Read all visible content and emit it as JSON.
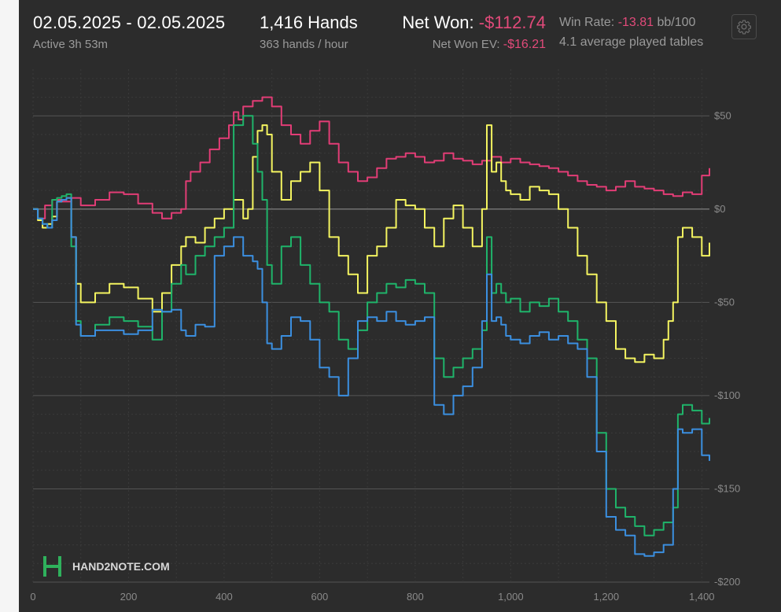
{
  "header": {
    "date_range": "02.05.2025 - 02.05.2025",
    "active": "Active 3h 53m",
    "hands": "1,416 Hands",
    "hands_per_hour": "363 hands / hour",
    "net_won_label": "Net Won: ",
    "net_won_value": "-$112.74",
    "net_won_ev_label": "Net Won  EV: ",
    "net_won_ev_value": "-$16.21",
    "win_rate_label": "Win Rate: ",
    "win_rate_value": "-13.81",
    "win_rate_unit": " bb/100",
    "avg_tables": "4.1 average played tables"
  },
  "settings": {
    "icon": "gear-icon"
  },
  "logo": {
    "text": "HAND2NOTE.COM"
  },
  "colors": {
    "background": "#2c2c2c",
    "negative": "#e24a7a",
    "pink": "#e23d76",
    "yellow": "#f4f460",
    "green": "#1fb46a",
    "blue": "#3b8fe0"
  },
  "chart_data": {
    "type": "line",
    "xlim": [
      0,
      1416
    ],
    "ylim": [
      -200,
      75
    ],
    "x_ticks": [
      0,
      200,
      400,
      600,
      800,
      1000,
      1200,
      1400
    ],
    "x_tick_labels": [
      "0",
      "200",
      "400",
      "600",
      "800",
      "1,000",
      "1,200",
      "1,400"
    ],
    "y_ticks": [
      50,
      0,
      -50,
      -100,
      -150,
      -200
    ],
    "y_tick_labels": [
      "$50",
      "$0",
      "-$50",
      "-$100",
      "-$150",
      "-$200"
    ],
    "grid": true,
    "series": [
      {
        "color": "#e23d76",
        "x": [
          0,
          10,
          25,
          40,
          60,
          80,
          100,
          130,
          160,
          190,
          220,
          250,
          270,
          290,
          310,
          320,
          330,
          350,
          370,
          390,
          410,
          420,
          430,
          440,
          460,
          480,
          500,
          520,
          540,
          560,
          580,
          600,
          620,
          640,
          660,
          680,
          700,
          720,
          740,
          760,
          780,
          800,
          820,
          840,
          860,
          880,
          900,
          920,
          940,
          960,
          980,
          1000,
          1020,
          1040,
          1060,
          1080,
          1100,
          1120,
          1140,
          1160,
          1180,
          1200,
          1220,
          1240,
          1260,
          1280,
          1300,
          1320,
          1340,
          1360,
          1380,
          1400,
          1416
        ],
        "y": [
          0,
          -5,
          2,
          5,
          4,
          6,
          2,
          5,
          9,
          8,
          3,
          -2,
          -5,
          -2,
          0,
          15,
          20,
          25,
          32,
          38,
          45,
          52,
          48,
          55,
          58,
          60,
          55,
          45,
          40,
          35,
          42,
          47,
          35,
          25,
          20,
          15,
          17,
          22,
          27,
          28,
          30,
          28,
          25,
          26,
          30,
          27,
          26,
          24,
          26,
          28,
          25,
          27,
          25,
          24,
          23,
          22,
          20,
          18,
          15,
          13,
          12,
          10,
          12,
          15,
          12,
          11,
          10,
          8,
          7,
          9,
          8,
          18,
          22
        ]
      },
      {
        "color": "#f4f460",
        "x": [
          0,
          10,
          20,
          30,
          40,
          50,
          60,
          70,
          80,
          90,
          100,
          130,
          160,
          190,
          220,
          250,
          270,
          290,
          310,
          320,
          340,
          360,
          380,
          400,
          420,
          440,
          450,
          460,
          470,
          480,
          490,
          500,
          520,
          540,
          560,
          580,
          600,
          620,
          640,
          660,
          680,
          700,
          720,
          740,
          760,
          780,
          800,
          820,
          840,
          860,
          880,
          900,
          920,
          940,
          950,
          960,
          970,
          980,
          990,
          1000,
          1020,
          1040,
          1060,
          1080,
          1100,
          1120,
          1140,
          1160,
          1180,
          1200,
          1220,
          1240,
          1260,
          1280,
          1300,
          1320,
          1330,
          1340,
          1350,
          1360,
          1380,
          1400,
          1416
        ],
        "y": [
          0,
          -6,
          -10,
          -8,
          -4,
          4,
          5,
          6,
          -15,
          -40,
          -50,
          -45,
          -40,
          -42,
          -48,
          -55,
          -45,
          -30,
          -20,
          -15,
          -18,
          -10,
          -5,
          0,
          5,
          -5,
          0,
          28,
          42,
          45,
          40,
          20,
          5,
          15,
          20,
          25,
          10,
          -15,
          -25,
          -35,
          -45,
          -25,
          -20,
          -10,
          5,
          2,
          0,
          -10,
          -20,
          -5,
          2,
          -10,
          -20,
          0,
          45,
          20,
          25,
          15,
          10,
          8,
          5,
          12,
          10,
          8,
          0,
          -10,
          -25,
          -35,
          -50,
          -60,
          -75,
          -80,
          -82,
          -78,
          -80,
          -70,
          -60,
          -50,
          -15,
          -10,
          -15,
          -25,
          -18
        ]
      },
      {
        "color": "#1fb46a",
        "x": [
          0,
          10,
          20,
          30,
          40,
          50,
          60,
          70,
          80,
          90,
          100,
          130,
          160,
          190,
          220,
          250,
          270,
          290,
          310,
          320,
          340,
          360,
          380,
          400,
          420,
          440,
          460,
          470,
          480,
          490,
          500,
          520,
          540,
          560,
          580,
          600,
          620,
          640,
          660,
          680,
          700,
          720,
          740,
          760,
          780,
          800,
          820,
          840,
          860,
          880,
          900,
          920,
          940,
          950,
          960,
          970,
          980,
          990,
          1000,
          1020,
          1040,
          1060,
          1080,
          1100,
          1120,
          1140,
          1160,
          1180,
          1200,
          1220,
          1240,
          1260,
          1280,
          1300,
          1320,
          1340,
          1350,
          1360,
          1380,
          1400,
          1416
        ],
        "y": [
          0,
          -5,
          -8,
          -10,
          5,
          6,
          7,
          8,
          -20,
          -60,
          -68,
          -62,
          -58,
          -60,
          -63,
          -70,
          -55,
          -40,
          -30,
          -35,
          -25,
          -20,
          -15,
          -10,
          45,
          50,
          35,
          20,
          5,
          -30,
          -40,
          -20,
          -15,
          -30,
          -40,
          -50,
          -55,
          -70,
          -75,
          -65,
          -50,
          -45,
          -40,
          -42,
          -38,
          -40,
          -45,
          -80,
          -90,
          -85,
          -80,
          -75,
          -65,
          -15,
          -45,
          -40,
          -45,
          -50,
          -48,
          -55,
          -50,
          -52,
          -48,
          -55,
          -60,
          -70,
          -80,
          -120,
          -150,
          -160,
          -165,
          -170,
          -175,
          -172,
          -168,
          -160,
          -110,
          -105,
          -108,
          -115,
          -112
        ]
      },
      {
        "color": "#3b8fe0",
        "x": [
          0,
          10,
          20,
          30,
          40,
          50,
          60,
          70,
          80,
          90,
          100,
          130,
          160,
          190,
          220,
          250,
          270,
          290,
          310,
          320,
          340,
          360,
          380,
          400,
          420,
          440,
          460,
          470,
          480,
          490,
          500,
          520,
          540,
          560,
          580,
          600,
          620,
          640,
          660,
          680,
          700,
          720,
          740,
          760,
          780,
          800,
          820,
          840,
          860,
          880,
          900,
          920,
          940,
          950,
          960,
          970,
          980,
          990,
          1000,
          1020,
          1040,
          1060,
          1080,
          1100,
          1120,
          1140,
          1160,
          1180,
          1200,
          1220,
          1240,
          1260,
          1280,
          1300,
          1320,
          1340,
          1350,
          1360,
          1380,
          1400,
          1416
        ],
        "y": [
          0,
          -5,
          -8,
          -10,
          -6,
          4,
          5,
          6,
          -15,
          -62,
          -68,
          -65,
          -65,
          -67,
          -65,
          -54,
          -55,
          -54,
          -65,
          -68,
          -62,
          -63,
          -25,
          -20,
          -15,
          -25,
          -28,
          -32,
          -50,
          -72,
          -75,
          -68,
          -58,
          -60,
          -70,
          -85,
          -90,
          -100,
          -80,
          -60,
          -58,
          -60,
          -55,
          -60,
          -62,
          -60,
          -58,
          -105,
          -110,
          -100,
          -95,
          -85,
          -60,
          -35,
          -60,
          -58,
          -62,
          -68,
          -70,
          -72,
          -68,
          -66,
          -70,
          -68,
          -72,
          -75,
          -90,
          -130,
          -165,
          -172,
          -175,
          -185,
          -186,
          -184,
          -180,
          -150,
          -118,
          -120,
          -118,
          -132,
          -135
        ]
      }
    ]
  }
}
